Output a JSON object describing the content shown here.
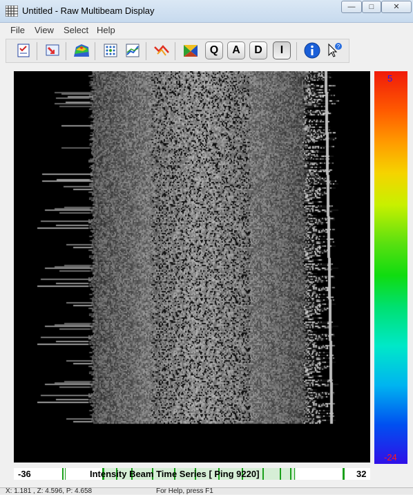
{
  "window": {
    "title": "Untitled - Raw Multibeam Display",
    "buttons": {
      "minimize": "—",
      "maximize": "□",
      "close": "✕"
    }
  },
  "menu": [
    "File",
    "View",
    "Select",
    "Help"
  ],
  "toolbar": {
    "icons": [
      "checklist-icon",
      "import-icon",
      "terrain-color-icon",
      "grid-icon",
      "profile-chart-icon",
      "tracking-icon",
      "pyramid-icon",
      "q-button",
      "a-button",
      "d-button",
      "i-button",
      "info-icon",
      "pointer-help-icon"
    ],
    "letters": {
      "q": "Q",
      "a": "A",
      "d": "D",
      "i": "I"
    }
  },
  "colors": {
    "scale_top": "#f01a0a",
    "scale_bottom": "#3010e8",
    "scale_max_text": "#1a1aff",
    "scale_min_text": "#ff1a1a",
    "axis_green": "#1aa01a"
  },
  "color_scale": {
    "max": "5",
    "min": "-24"
  },
  "axis": {
    "left": "-36",
    "right": "32",
    "title": "Intensity Beam Time Series [ Ping 9220]"
  },
  "status": {
    "coords": "X: 1.181 , Z: 4.596, P: 4.658",
    "help": "For Help, press F1"
  }
}
